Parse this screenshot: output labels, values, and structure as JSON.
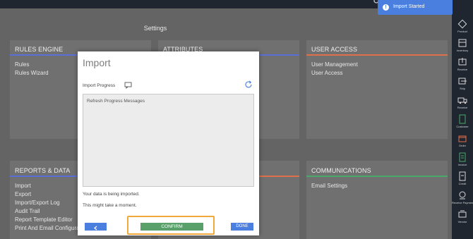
{
  "page": {
    "title": "Settings"
  },
  "toast": {
    "text": "Import Started",
    "icon": "info-icon",
    "icon_glyph": "!"
  },
  "cards": {
    "rules_engine": {
      "title": "RULES ENGINE",
      "accent": "#5b6fd8",
      "links": [
        "Rules",
        "Rules Wizard"
      ]
    },
    "attributes": {
      "title": "ATTRIBUTES",
      "accent": "#5b6fd8"
    },
    "user_access": {
      "title": "USER ACCESS",
      "accent": "#e0704a",
      "links": [
        "User Management",
        "User Access"
      ]
    },
    "reports_data": {
      "title": "REPORTS & DATA",
      "accent": "#5b6fd8",
      "links": [
        "Import",
        "Export",
        "Import/Export Log",
        "Audit Trail",
        "Report Template Editor",
        "Print And Email Configurati"
      ]
    },
    "middle_lower": {
      "accent": "#e0704a"
    },
    "communications": {
      "title": "COMMUNICATIONS",
      "accent": "#4aa86b",
      "links": [
        "Email Settings"
      ]
    }
  },
  "sidebar": {
    "items": [
      {
        "label": "Product",
        "icon": "product-icon"
      },
      {
        "label": "Inventory",
        "icon": "inventory-icon"
      },
      {
        "label": "Receive",
        "icon": "receive-icon"
      },
      {
        "label": "Ship",
        "icon": "ship-icon"
      },
      {
        "label": "Receive",
        "icon": "truck-icon"
      },
      {
        "label": "Customer",
        "icon": "customer-icon"
      },
      {
        "label": "Order",
        "icon": "order-icon"
      },
      {
        "label": "Invoice",
        "icon": "invoice-icon"
      },
      {
        "label": "Credit",
        "icon": "credit-icon"
      },
      {
        "label": "Receive Paymen",
        "icon": "payment-icon"
      },
      {
        "label": "Vendor",
        "icon": "vendor-icon"
      }
    ]
  },
  "modal": {
    "title": "Import",
    "progress_label": "Import Progress",
    "message_placeholder": "Refresh Progress Messages",
    "status_line1": "Your data is being imported.",
    "status_line2": "This might take a moment.",
    "confirm_label": "CONFIRM",
    "done_label": "DONE",
    "back_glyph": "<"
  },
  "colors": {
    "primary": "#4a7fe0",
    "confirm": "#5aa06b",
    "highlight": "#f0a93a"
  }
}
